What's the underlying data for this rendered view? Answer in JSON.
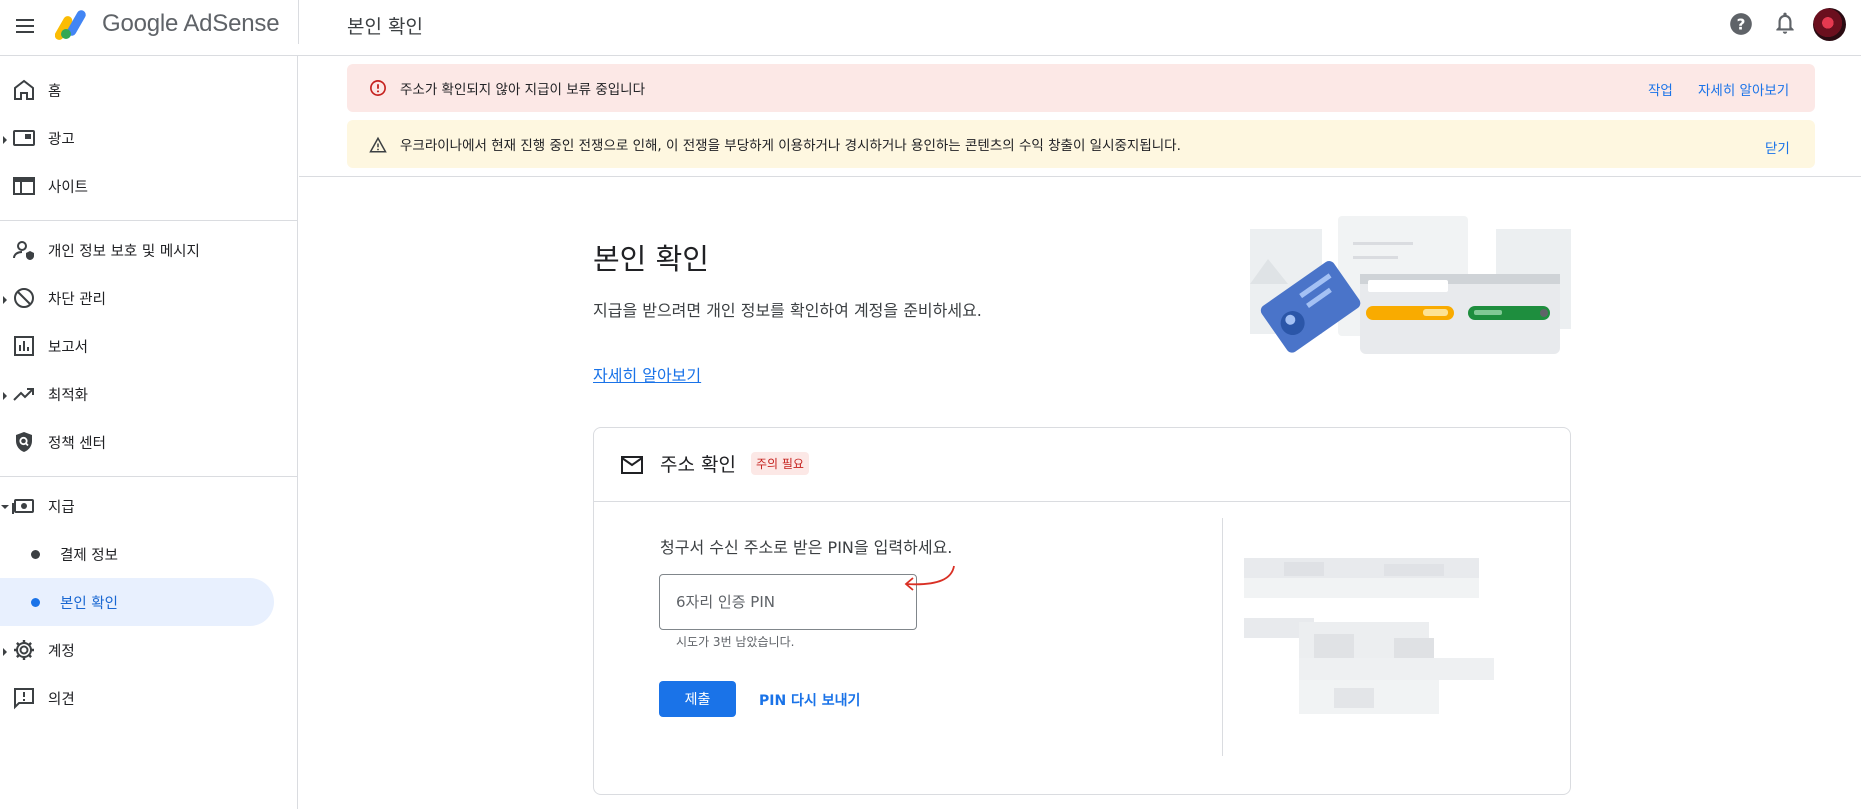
{
  "header": {
    "app_name": "Google AdSense",
    "page_title": "본인 확인"
  },
  "sidebar": {
    "items": [
      {
        "label": "홈"
      },
      {
        "label": "광고"
      },
      {
        "label": "사이트"
      },
      {
        "label": "개인 정보 보호 및 메시지"
      },
      {
        "label": "차단 관리"
      },
      {
        "label": "보고서"
      },
      {
        "label": "최적화"
      },
      {
        "label": "정책 센터"
      },
      {
        "label": "지급"
      },
      {
        "label": "결제 정보"
      },
      {
        "label": "본인 확인"
      },
      {
        "label": "계정"
      },
      {
        "label": "의견"
      }
    ]
  },
  "alerts": {
    "error": {
      "text": "주소가 확인되지 않아 지급이 보류 중입니다",
      "action_label": "작업",
      "learn_more_label": "자세히 알아보기"
    },
    "warning": {
      "text": "우크라이나에서 현재 진행 중인 전쟁으로 인해, 이 전쟁을 부당하게 이용하거나 경시하거나 용인하는 콘텐츠의 수익 창출이 일시중지됩니다.",
      "close_label": "닫기"
    }
  },
  "hero": {
    "title": "본인 확인",
    "description": "지급을 받으려면 개인 정보를 확인하여 계정을 준비하세요.",
    "link_label": "자세히 알아보기"
  },
  "card": {
    "title": "주소 확인",
    "badge": "주의 필요",
    "prompt": "청구서 수신 주소로 받은 PIN을 입력하세요.",
    "pin_placeholder": "6자리 인증 PIN",
    "pin_value": "",
    "attempts_text": "시도가 3번 남았습니다.",
    "submit_label": "제출",
    "resend_label": "PIN 다시 보내기"
  },
  "colors": {
    "accent": "#1a73e8",
    "error_bg": "#fce8e6",
    "warning_bg": "#fef7e0",
    "active_nav_bg": "#e8f0fe",
    "annotation_arrow": "#d93025"
  }
}
